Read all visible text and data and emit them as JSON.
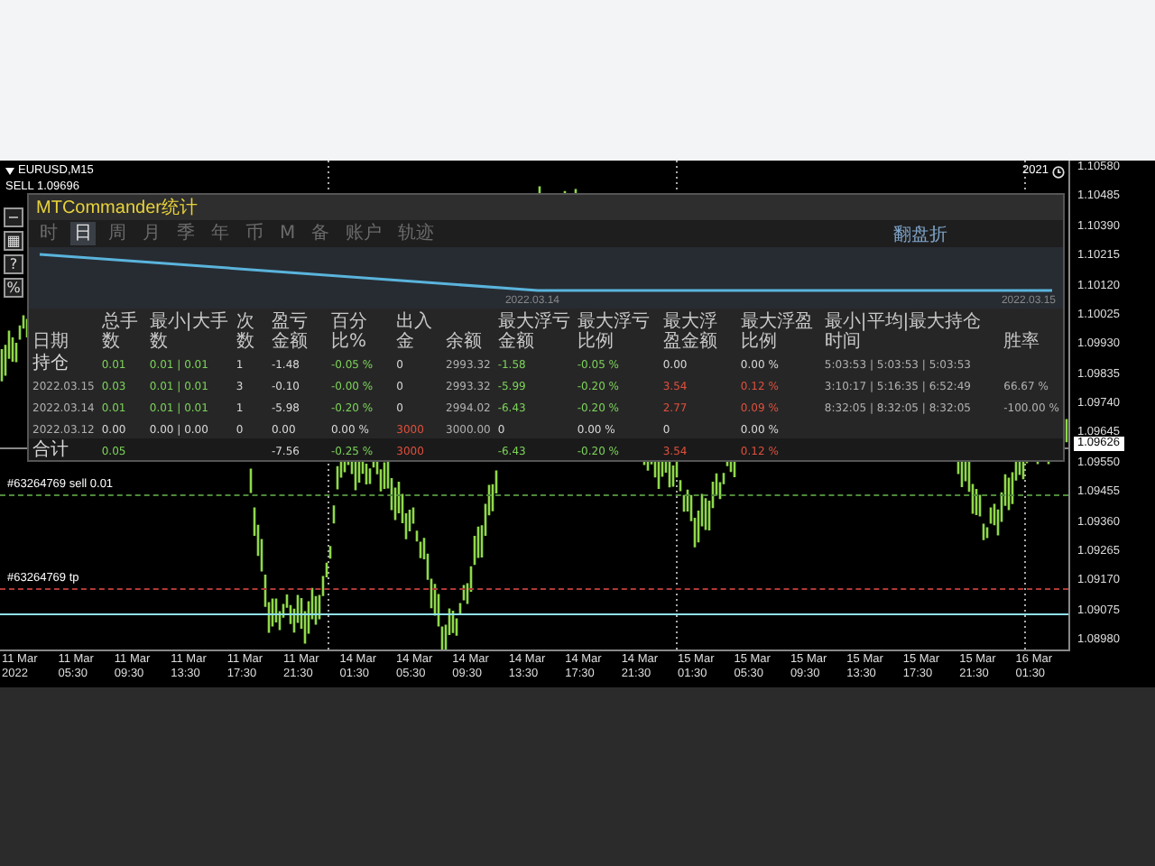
{
  "chart": {
    "symbol": "EURUSD,M15",
    "order": "SELL  1.09696",
    "corner": "2021",
    "current_price": "1.09626",
    "levels": [
      {
        "label": "#63264769 sell 0.01",
        "kind": "sell"
      },
      {
        "label": "#63264769 tp",
        "kind": "tp"
      }
    ],
    "price_axis": [
      "1.10580",
      "1.10485",
      "1.10390",
      "1.10215",
      "1.10120",
      "1.10025",
      "1.09930",
      "1.09835",
      "1.09740",
      "1.09645",
      "1.09550",
      "1.09455",
      "1.09360",
      "1.09265",
      "1.09170",
      "1.09075",
      "1.08980"
    ],
    "time_axis": [
      "11 Mar 2022",
      "11 Mar 05:30",
      "11 Mar 09:30",
      "11 Mar 13:30",
      "11 Mar 17:30",
      "11 Mar 21:30",
      "14 Mar 01:30",
      "14 Mar 05:30",
      "14 Mar 09:30",
      "14 Mar 13:30",
      "14 Mar 17:30",
      "14 Mar 21:30",
      "15 Mar 01:30",
      "15 Mar 05:30",
      "15 Mar 09:30",
      "15 Mar 13:30",
      "15 Mar 17:30",
      "15 Mar 21:30",
      "16 Mar 01:30"
    ]
  },
  "side_buttons": [
    "−",
    "▦",
    "?",
    "%"
  ],
  "panel": {
    "title": "MTCommander统计",
    "tabs": [
      {
        "label": "时",
        "selected": false
      },
      {
        "label": "日",
        "selected": true
      },
      {
        "label": "周",
        "selected": false
      },
      {
        "label": "月",
        "selected": false
      },
      {
        "label": "季",
        "selected": false
      },
      {
        "label": "年",
        "selected": false
      },
      {
        "label": "币",
        "selected": false
      },
      {
        "label": "M",
        "selected": false
      },
      {
        "label": "备",
        "selected": false
      },
      {
        "label": "账户",
        "selected": false
      },
      {
        "label": "轨迹",
        "selected": false
      }
    ],
    "mode": "翻盘折",
    "chart_dates": [
      "2022.03.14",
      "2022.03.15"
    ],
    "columns": [
      "日期",
      "总手数",
      "最小|大手数",
      "次数",
      "盈亏金额",
      "百分比%",
      "出入金",
      "余额",
      "最大浮亏金额",
      "最大浮亏比例",
      "最大浮盈金额",
      "最大浮盈比例",
      "最小|平均|最大持仓时间",
      "胜率"
    ],
    "rows": [
      {
        "kind": "row",
        "cells": [
          {
            "text": "持仓",
            "color": "#d8d8d8"
          },
          {
            "text": "0.01",
            "color": "#7cd35a"
          },
          {
            "text": "0.01 | 0.01",
            "color": "#7cd35a"
          },
          {
            "text": "1",
            "color": "#d8d8d8"
          },
          {
            "text": "-1.48",
            "color": "#d8d8d8"
          },
          {
            "text": "-0.05 %",
            "color": "#7cd35a"
          },
          {
            "text": "0",
            "color": "#d8d8d8"
          },
          {
            "text": "2993.32",
            "color": "#b0b0b0"
          },
          {
            "text": "-1.58",
            "color": "#7cd35a"
          },
          {
            "text": "-0.05 %",
            "color": "#7cd35a"
          },
          {
            "text": "0.00",
            "color": "#d8d8d8"
          },
          {
            "text": "0.00 %",
            "color": "#d8d8d8"
          },
          {
            "text": "5:03:53 | 5:03:53 | 5:03:53",
            "color": "#b0b0b0"
          },
          null
        ]
      },
      {
        "kind": "row",
        "cells": [
          {
            "text": "2022.03.15",
            "color": "#b0b0b0"
          },
          {
            "text": "0.03",
            "color": "#7cd35a"
          },
          {
            "text": "0.01 | 0.01",
            "color": "#7cd35a"
          },
          {
            "text": "3",
            "color": "#d8d8d8"
          },
          {
            "text": "-0.10",
            "color": "#d8d8d8"
          },
          {
            "text": "-0.00 %",
            "color": "#7cd35a"
          },
          {
            "text": "0",
            "color": "#d8d8d8"
          },
          {
            "text": "2993.32",
            "color": "#b0b0b0"
          },
          {
            "text": "-5.99",
            "color": "#7cd35a"
          },
          {
            "text": "-0.20 %",
            "color": "#7cd35a"
          },
          {
            "text": "3.54",
            "color": "#e0503c"
          },
          {
            "text": "0.12 %",
            "color": "#e0503c"
          },
          {
            "text": "3:10:17 | 5:16:35 | 6:52:49",
            "color": "#b0b0b0"
          },
          {
            "text": "66.67 %",
            "color": "#b0b0b0"
          }
        ]
      },
      {
        "kind": "row",
        "cells": [
          {
            "text": "2022.03.14",
            "color": "#b0b0b0"
          },
          {
            "text": "0.01",
            "color": "#7cd35a"
          },
          {
            "text": "0.01 | 0.01",
            "color": "#7cd35a"
          },
          {
            "text": "1",
            "color": "#d8d8d8"
          },
          {
            "text": "-5.98",
            "color": "#d8d8d8"
          },
          {
            "text": "-0.20 %",
            "color": "#7cd35a"
          },
          {
            "text": "0",
            "color": "#d8d8d8"
          },
          {
            "text": "2994.02",
            "color": "#b0b0b0"
          },
          {
            "text": "-6.43",
            "color": "#7cd35a"
          },
          {
            "text": "-0.20 %",
            "color": "#7cd35a"
          },
          {
            "text": "2.77",
            "color": "#e0503c"
          },
          {
            "text": "0.09 %",
            "color": "#e0503c"
          },
          {
            "text": "8:32:05 | 8:32:05 | 8:32:05",
            "color": "#b0b0b0"
          },
          {
            "text": "-100.00 %",
            "color": "#b0b0b0"
          }
        ]
      },
      {
        "kind": "row",
        "cells": [
          {
            "text": "2022.03.12",
            "color": "#b0b0b0"
          },
          {
            "text": "0.00",
            "color": "#d8d8d8"
          },
          {
            "text": "0.00 | 0.00",
            "color": "#d8d8d8"
          },
          {
            "text": "0",
            "color": "#d8d8d8"
          },
          {
            "text": "0.00",
            "color": "#d8d8d8"
          },
          {
            "text": "0.00 %",
            "color": "#d8d8d8"
          },
          {
            "text": "3000",
            "color": "#e0503c"
          },
          {
            "text": "3000.00",
            "color": "#b0b0b0"
          },
          {
            "text": "0",
            "color": "#d8d8d8"
          },
          {
            "text": "0.00 %",
            "color": "#d8d8d8"
          },
          {
            "text": "0",
            "color": "#d8d8d8"
          },
          {
            "text": "0.00 %",
            "color": "#d8d8d8"
          },
          null,
          null
        ]
      },
      {
        "kind": "total",
        "cells": [
          {
            "text": "合计",
            "color": "#d8d8d8"
          },
          {
            "text": "0.05",
            "color": "#7cd35a"
          },
          null,
          null,
          {
            "text": "-7.56",
            "color": "#d8d8d8"
          },
          {
            "text": "-0.25 %",
            "color": "#7cd35a"
          },
          {
            "text": "3000",
            "color": "#e0503c"
          },
          null,
          {
            "text": "-6.43",
            "color": "#7cd35a"
          },
          {
            "text": "-0.20 %",
            "color": "#7cd35a"
          },
          {
            "text": "3.54",
            "color": "#e0503c"
          },
          {
            "text": "0.12 %",
            "color": "#e0503c"
          },
          null,
          null
        ]
      }
    ]
  }
}
